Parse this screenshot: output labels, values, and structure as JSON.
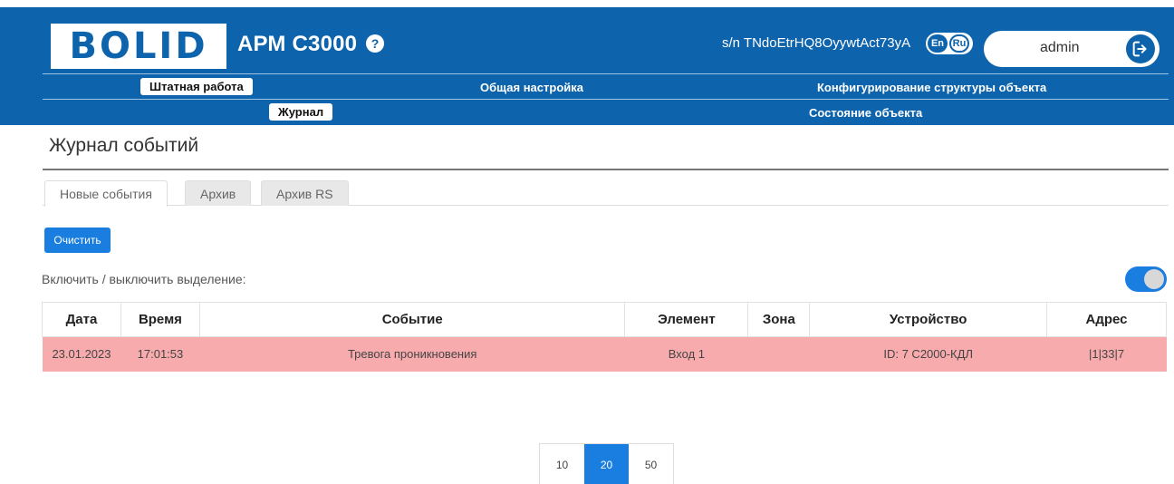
{
  "header": {
    "logo_text": "BOLID",
    "app_title": "АРМ С3000",
    "help": "?",
    "serial": "s/n TNdoEtrHQ8OyywtAct73yA",
    "lang_en": "En",
    "lang_ru": "Ru",
    "user": "admin"
  },
  "nav": {
    "row1": [
      "Штатная работа",
      "Общая настройка",
      "Конфигурирование структуры объекта"
    ],
    "row2": [
      "Журнал",
      "Состояние объекта"
    ],
    "active_row1": "Штатная работа",
    "active_row2": "Журнал"
  },
  "page": {
    "title": "Журнал событий",
    "tabs": [
      "Новые события",
      "Архив",
      "Архив RS"
    ],
    "active_tab": "Новые события",
    "clear_button": "Очистить",
    "highlight_label": "Включить / выключить выделение:",
    "highlight_enabled": true
  },
  "table": {
    "columns": [
      "Дата",
      "Время",
      "Событие",
      "Элемент",
      "Зона",
      "Устройство",
      "Адрес"
    ],
    "rows": [
      [
        "23.01.2023",
        "17:01:53",
        "Тревога проникновения",
        "Вход 1",
        "",
        "ID: 7 С2000-КДЛ",
        "|1|33|7"
      ]
    ]
  },
  "pagination": {
    "sizes": [
      "10",
      "20",
      "50"
    ],
    "active": "20"
  },
  "colors": {
    "brand_blue": "#0e64ac",
    "accent_blue": "#1a7ee0",
    "alarm_row": "#f8abad"
  }
}
